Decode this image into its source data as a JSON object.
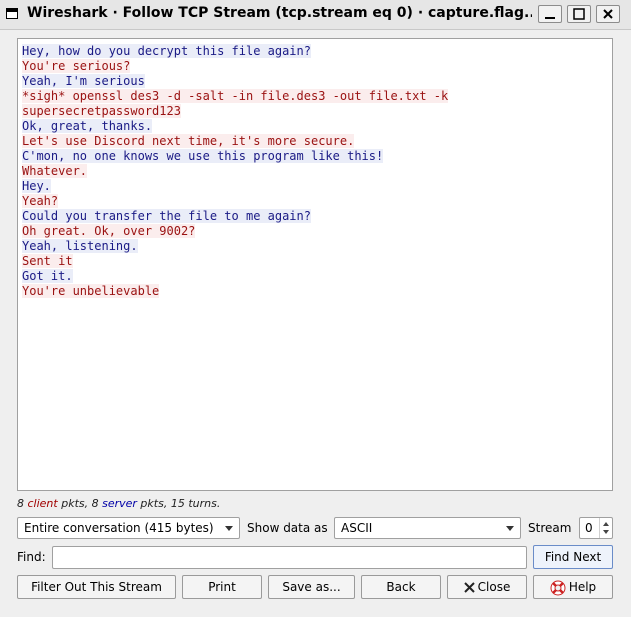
{
  "window": {
    "title": "Wireshark · Follow TCP Stream (tcp.stream eq 0) · capture.flag...."
  },
  "stream": {
    "lines": [
      {
        "side": "client",
        "text": "Hey, how do you decrypt this file again?"
      },
      {
        "side": "server",
        "text": "You're serious?"
      },
      {
        "side": "client",
        "text": "Yeah, I'm serious"
      },
      {
        "side": "server",
        "text": "*sigh* openssl des3 -d -salt -in file.des3 -out file.txt -k"
      },
      {
        "side": "server",
        "text": "supersecretpassword123"
      },
      {
        "side": "client",
        "text": "Ok, great, thanks."
      },
      {
        "side": "server",
        "text": "Let's use Discord next time, it's more secure."
      },
      {
        "side": "client",
        "text": "C'mon, no one knows we use this program like this!"
      },
      {
        "side": "server",
        "text": "Whatever."
      },
      {
        "side": "client",
        "text": "Hey."
      },
      {
        "side": "server",
        "text": "Yeah?"
      },
      {
        "side": "client",
        "text": "Could you transfer the file to me again?"
      },
      {
        "side": "server",
        "text": "Oh great. Ok, over 9002?"
      },
      {
        "side": "client",
        "text": "Yeah, listening."
      },
      {
        "side": "server",
        "text": "Sent it"
      },
      {
        "side": "client",
        "text": "Got it."
      },
      {
        "side": "server",
        "text": "You're unbelievable"
      }
    ]
  },
  "stats": {
    "client_count": "8",
    "client_word": "client",
    "pkts_sep": " pkts, ",
    "server_count": "8",
    "server_word": "server",
    "tail": " pkts, 15 turns."
  },
  "controls": {
    "conversation_select": "Entire conversation (415 bytes)",
    "show_data_label": "Show data as",
    "show_data_value": "ASCII",
    "stream_label": "Stream",
    "stream_value": "0",
    "find_label": "Find:",
    "find_value": "",
    "find_next": "Find Next"
  },
  "buttons": {
    "filter_out": "Filter Out This Stream",
    "print": "Print",
    "save_as": "Save as...",
    "back": "Back",
    "close": "Close",
    "help": "Help"
  },
  "colors": {
    "client_fg": "#1a1a85",
    "client_bg": "#eaedf8",
    "server_fg": "#9a1111",
    "server_bg": "#fbeded"
  }
}
